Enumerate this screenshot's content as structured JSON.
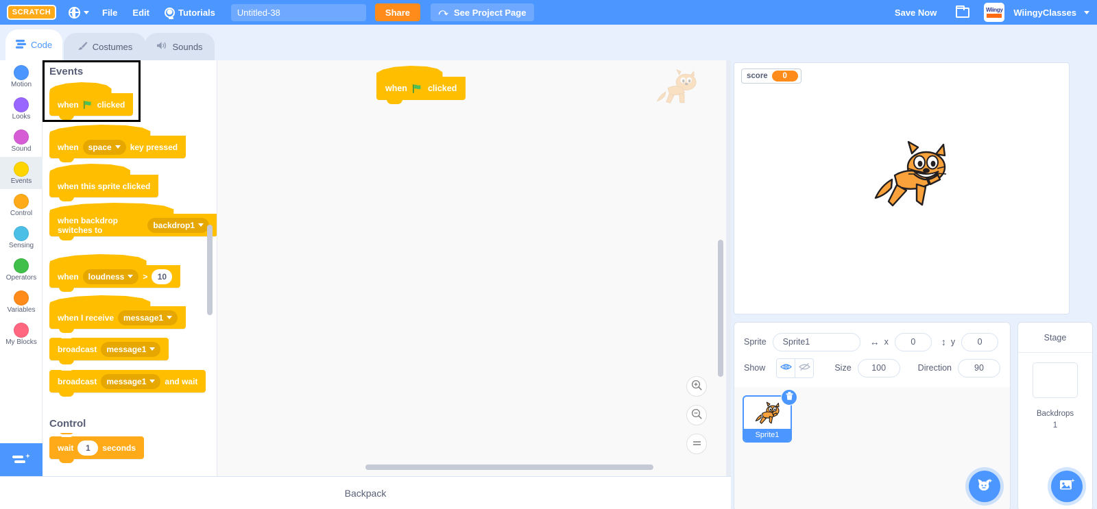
{
  "menubar": {
    "logo_text": "SCRATCH",
    "globe_icon": "globe-icon",
    "file_label": "File",
    "edit_label": "Edit",
    "tutorials_label": "Tutorials",
    "bulb_icon": "lightbulb-icon",
    "project_title": "Untitled-38",
    "project_title_placeholder": "Project title",
    "share_label": "Share",
    "see_project_page_label": "See Project Page",
    "see_project_page_icon": "share-curve-icon",
    "save_now_label": "Save Now",
    "folder_icon": "folder-icon",
    "account_logo_top": "Wiingy",
    "account_name": "WiingyClasses",
    "account_caret_icon": "chevron-down-icon",
    "accent_blue": "#4c97ff",
    "accent_orange": "#ff8c1a"
  },
  "tabs": [
    {
      "label": "Code",
      "icon": "code-blocks-icon",
      "active": true
    },
    {
      "label": "Costumes",
      "icon": "paintbrush-icon",
      "active": false
    },
    {
      "label": "Sounds",
      "icon": "speaker-icon",
      "active": false
    }
  ],
  "stage_controls": {
    "green_flag_icon": "green-flag-icon",
    "stop_icon": "stop-sign-icon",
    "small_stage_icon": "small-stage-layout-icon",
    "large_stage_icon": "large-stage-layout-icon",
    "fullscreen_icon": "fullscreen-icon"
  },
  "categories": [
    {
      "label": "Motion",
      "color": "#4c97ff",
      "active": false
    },
    {
      "label": "Looks",
      "color": "#9966ff",
      "active": false
    },
    {
      "label": "Sound",
      "color": "#d65cd6",
      "active": false
    },
    {
      "label": "Events",
      "color": "#ffd500",
      "active": true
    },
    {
      "label": "Control",
      "color": "#ffab19",
      "active": false
    },
    {
      "label": "Sensing",
      "color": "#4cbfe6",
      "active": false
    },
    {
      "label": "Operators",
      "color": "#40bf4a",
      "active": false
    },
    {
      "label": "Variables",
      "color": "#ff8c1a",
      "active": false
    },
    {
      "label": "My Blocks",
      "color": "#ff6680",
      "active": false
    }
  ],
  "extension_button": {
    "icon": "add-extension-icon"
  },
  "palette": {
    "events_header": "Events",
    "control_header": "Control",
    "blocks": {
      "when_flag_clicked": {
        "pre": "when",
        "flag_icon": "green-flag-icon",
        "post": "clicked",
        "selected": true
      },
      "when_key_pressed": {
        "pre": "when",
        "field": "space",
        "post": "key pressed"
      },
      "when_sprite_clicked": {
        "text": "when this sprite clicked"
      },
      "when_backdrop_switches": {
        "pre": "when backdrop switches to",
        "field": "backdrop1"
      },
      "when_loudness": {
        "pre": "when",
        "field": "loudness",
        "op": ">",
        "value": "10"
      },
      "when_i_receive": {
        "pre": "when I receive",
        "field": "message1"
      },
      "broadcast": {
        "pre": "broadcast",
        "field": "message1"
      },
      "broadcast_and_wait": {
        "pre": "broadcast",
        "field": "message1",
        "post": "and wait"
      },
      "wait_seconds": {
        "pre": "wait",
        "value": "1",
        "post": "seconds"
      }
    }
  },
  "workspace": {
    "block": {
      "pre": "when",
      "flag_icon": "green-flag-icon",
      "post": "clicked"
    },
    "watermark_icon": "scratch-cat-watermark",
    "zoom_in_icon": "zoom-in-icon",
    "zoom_out_icon": "zoom-out-icon",
    "zoom_reset_icon": "zoom-reset-icon"
  },
  "stage": {
    "monitor": {
      "label": "score",
      "value": "0"
    },
    "sprite_icon": "scratch-cat"
  },
  "sprite_panel": {
    "sprite_label": "Sprite",
    "sprite_name": "Sprite1",
    "x_label": "x",
    "x_value": "0",
    "x_icon": "horizontal-arrows-icon",
    "y_label": "y",
    "y_value": "0",
    "y_icon": "vertical-arrows-icon",
    "show_label": "Show",
    "show_on_icon": "eye-icon",
    "show_off_icon": "eye-slash-icon",
    "size_label": "Size",
    "size_value": "100",
    "direction_label": "Direction",
    "direction_value": "90",
    "sprites": [
      {
        "name": "Sprite1",
        "icon": "scratch-cat",
        "selected": true,
        "delete_icon": "trash-icon"
      }
    ],
    "add_sprite_icon": "add-sprite-cat-icon"
  },
  "stage_panel": {
    "title": "Stage",
    "backdrops_label": "Backdrops",
    "backdrops_count": "1",
    "add_backdrop_icon": "add-backdrop-image-icon"
  },
  "backpack": {
    "label": "Backpack"
  }
}
